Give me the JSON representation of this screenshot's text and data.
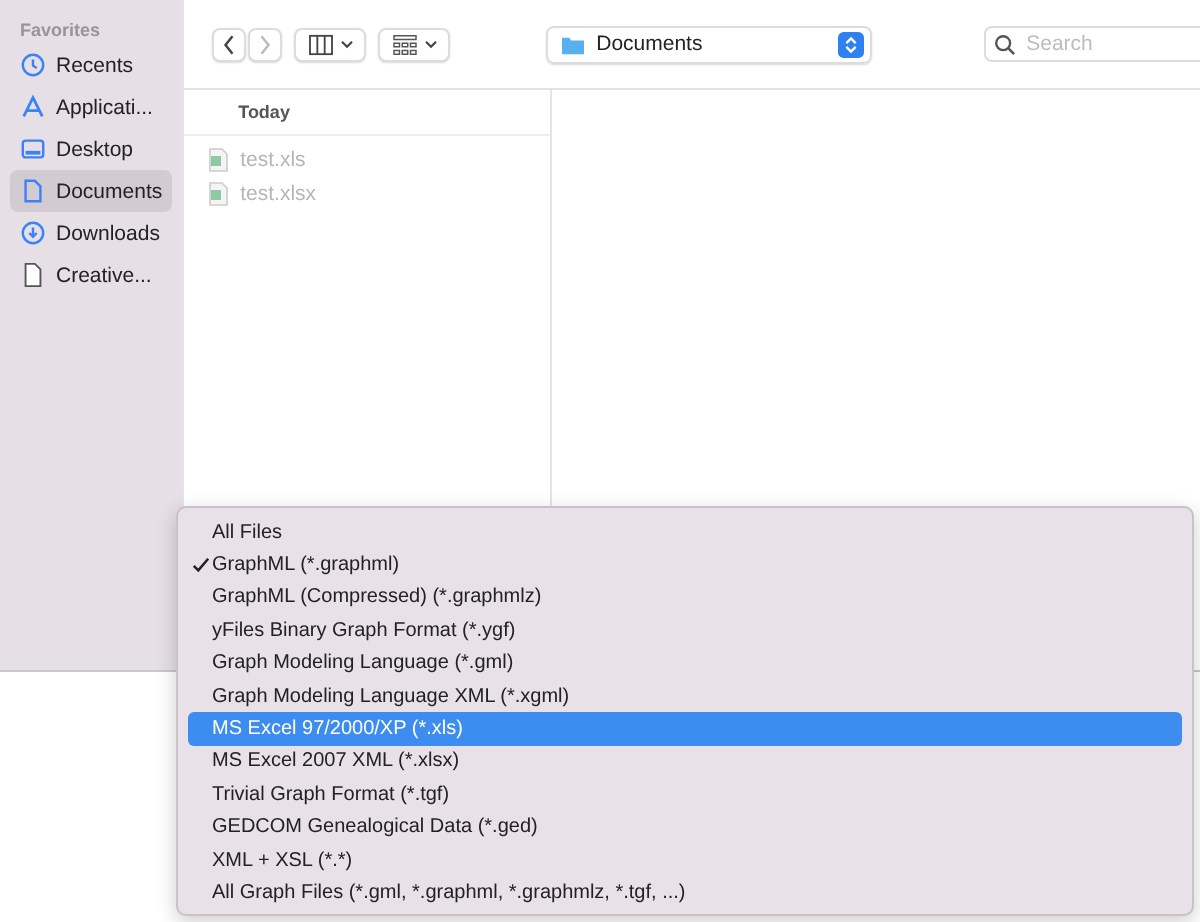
{
  "sidebar": {
    "heading": "Favorites",
    "items": [
      {
        "label": "Recents",
        "selected": false
      },
      {
        "label": "Applicati...",
        "selected": false
      },
      {
        "label": "Desktop",
        "selected": false
      },
      {
        "label": "Documents",
        "selected": true
      },
      {
        "label": "Downloads",
        "selected": false
      },
      {
        "label": "Creative...",
        "selected": false
      }
    ]
  },
  "toolbar": {
    "location": "Documents",
    "search": {
      "placeholder": "Search"
    }
  },
  "file_list": {
    "header": "Today",
    "files": [
      {
        "name": "test.xls",
        "disabled": true
      },
      {
        "name": "test.xlsx",
        "disabled": true
      }
    ]
  },
  "format_menu": {
    "items": [
      {
        "label": "All Files",
        "checked": false,
        "selected": false
      },
      {
        "label": "GraphML (*.graphml)",
        "checked": true,
        "selected": false
      },
      {
        "label": "GraphML (Compressed) (*.graphmlz)",
        "checked": false,
        "selected": false
      },
      {
        "label": "yFiles Binary Graph Format (*.ygf)",
        "checked": false,
        "selected": false
      },
      {
        "label": "Graph Modeling Language (*.gml)",
        "checked": false,
        "selected": false
      },
      {
        "label": "Graph Modeling Language XML (*.xgml)",
        "checked": false,
        "selected": false
      },
      {
        "label": "MS Excel 97/2000/XP (*.xls)",
        "checked": false,
        "selected": true
      },
      {
        "label": "MS Excel 2007 XML (*.xlsx)",
        "checked": false,
        "selected": false
      },
      {
        "label": "Trivial Graph Format (*.tgf)",
        "checked": false,
        "selected": false
      },
      {
        "label": "GEDCOM Genealogical Data (*.ged)",
        "checked": false,
        "selected": false
      },
      {
        "label": "XML + XSL (*.*)",
        "checked": false,
        "selected": false
      },
      {
        "label": "All Graph Files (*.gml, *.graphml, *.graphmlz, *.tgf, ...)",
        "checked": false,
        "selected": false
      }
    ]
  }
}
